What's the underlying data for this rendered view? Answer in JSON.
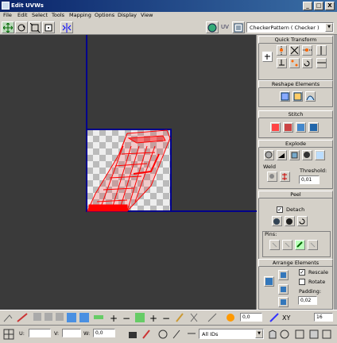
{
  "window": {
    "title": "Edit UVWs",
    "minimize": "_",
    "maximize": "□",
    "close": "X"
  },
  "menu": [
    "File",
    "Edit",
    "Select",
    "Tools",
    "Mapping",
    "Options",
    "Display",
    "View"
  ],
  "toolbar": {
    "uv_label": "UV",
    "texture_dropdown": "CheckerPattern  ( Checker )"
  },
  "panels": {
    "quick_transform": "Quick Transform",
    "reshape": "Reshape Elements",
    "stitch": "Stitch",
    "explode": "Explode",
    "weld": "Weld",
    "threshold_label": "Threshold:",
    "threshold_value": "0,01",
    "peel": "Peel",
    "detach": "Detach",
    "pins": "Pins:",
    "arrange": "Arrange Elements",
    "rescale": "Rescale",
    "rotate": "Rotate",
    "padding_label": "Padding:",
    "padding_value": "0,02"
  },
  "bottom1": {
    "offset_value": "0,0",
    "xy_label": "XY",
    "zoom_value": "16"
  },
  "bottom2": {
    "u_label": "U:",
    "v_label": "V:",
    "w_label": "W:",
    "w_value": "0,0",
    "ids_dropdown": "All IDs"
  },
  "colors": {
    "uv_mesh": "#ff0000",
    "grid_line": "#00008b",
    "viewport_bg": "#3a3a3a"
  }
}
